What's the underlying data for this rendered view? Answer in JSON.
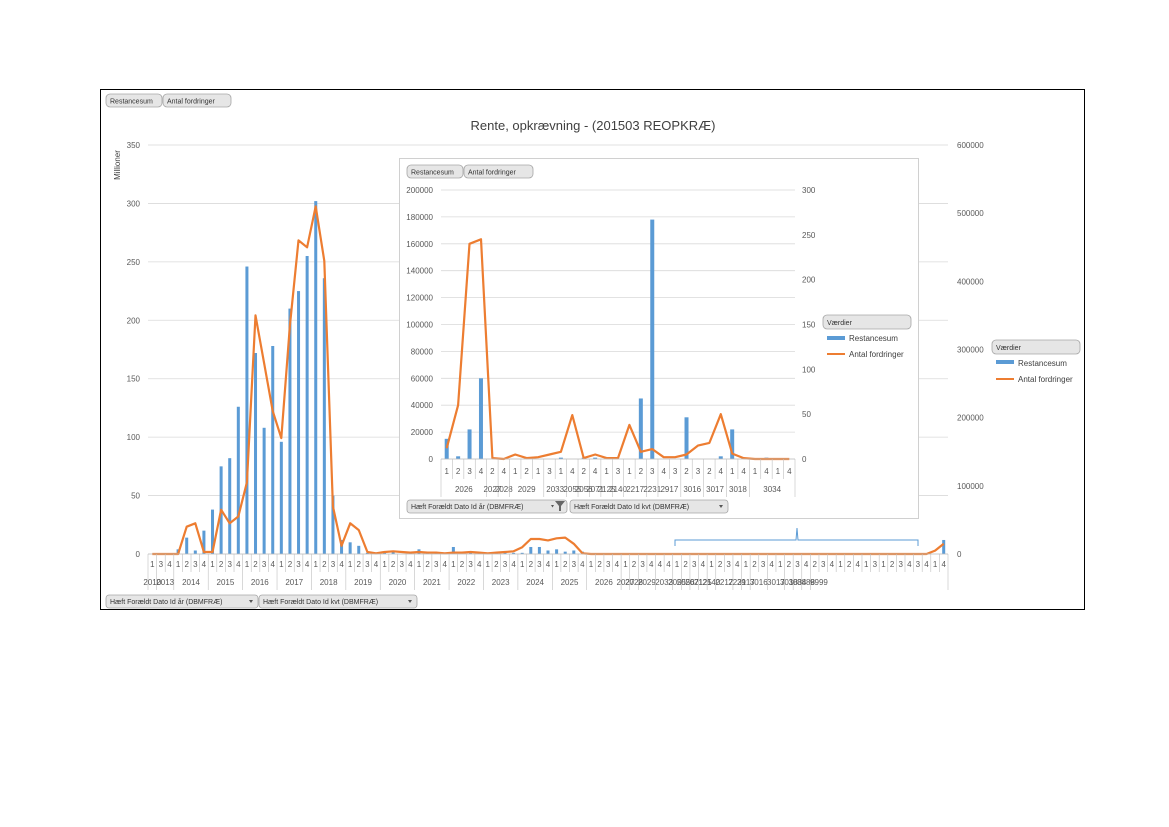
{
  "chart_data": [
    {
      "type": "bar",
      "title": "Rente, opkrævning - (201503 REOPKRÆ)",
      "ylabel": "Millioner",
      "ylim": [
        0,
        350
      ],
      "y2lim": [
        0,
        600000
      ],
      "yticks": [
        "0",
        "50",
        "100",
        "150",
        "200",
        "250",
        "300",
        "350"
      ],
      "y2ticks": [
        "0",
        "100000",
        "200000",
        "300000",
        "400000",
        "500000",
        "600000"
      ],
      "pivot_value_buttons": [
        "Restancesum",
        "Antal fordringer"
      ],
      "pivot_field_buttons": [
        "Hæft Forældt Dato Id år (DBMFRÆ)",
        "Hæft Forældt Dato Id kvt (DBMFRÆ)"
      ],
      "legend_title": "Værdier",
      "legend_position": "right",
      "grid": true,
      "quarters": [
        "1",
        "3",
        "4",
        "1",
        "2",
        "3",
        "4",
        "1",
        "2",
        "3",
        "4",
        "1",
        "2",
        "3",
        "4",
        "1",
        "2",
        "3",
        "4",
        "1",
        "2",
        "3",
        "4",
        "1",
        "2",
        "3",
        "4",
        "1",
        "2",
        "3",
        "4",
        "1",
        "2",
        "3",
        "4",
        "1",
        "2",
        "3",
        "4",
        "1",
        "2",
        "3",
        "4",
        "1",
        "2",
        "3",
        "4",
        "1",
        "2",
        "3",
        "4",
        "1",
        "2",
        "3",
        "4",
        "1",
        "2",
        "3",
        "4",
        "4",
        "4",
        "1",
        "2",
        "3",
        "4",
        "1",
        "2",
        "3",
        "4",
        "1",
        "2",
        "3",
        "4",
        "1",
        "2",
        "3",
        "4",
        "2",
        "3",
        "4",
        "1",
        "2",
        "4",
        "1",
        "3",
        "1",
        "2",
        "3",
        "4",
        "3",
        "4",
        "1",
        "4"
      ],
      "years": [
        {
          "label": "2010",
          "start": 0,
          "count": 1
        },
        {
          "label": "2013",
          "start": 1,
          "count": 2
        },
        {
          "label": "2014",
          "start": 3,
          "count": 4
        },
        {
          "label": "2015",
          "start": 7,
          "count": 4
        },
        {
          "label": "2016",
          "start": 11,
          "count": 4
        },
        {
          "label": "2017",
          "start": 15,
          "count": 4
        },
        {
          "label": "2018",
          "start": 19,
          "count": 4
        },
        {
          "label": "2019",
          "start": 23,
          "count": 4
        },
        {
          "label": "2020",
          "start": 27,
          "count": 4
        },
        {
          "label": "2021",
          "start": 31,
          "count": 4
        },
        {
          "label": "2022",
          "start": 35,
          "count": 4
        },
        {
          "label": "2023",
          "start": 39,
          "count": 4
        },
        {
          "label": "2024",
          "start": 43,
          "count": 4
        },
        {
          "label": "2025",
          "start": 47,
          "count": 4
        },
        {
          "label": "2026",
          "start": 51,
          "count": 4
        },
        {
          "label": "2027",
          "start": 55,
          "count": 1
        },
        {
          "label": "2028",
          "start": 56,
          "count": 1
        },
        {
          "label": "2029",
          "start": 57,
          "count": 2
        },
        {
          "label": "2033",
          "start": 59,
          "count": 2
        },
        {
          "label": "2055",
          "start": 61,
          "count": 1
        },
        {
          "label": "2056",
          "start": 62,
          "count": 1
        },
        {
          "label": "2071",
          "start": 63,
          "count": 1
        },
        {
          "label": "2125",
          "start": 64,
          "count": 1
        },
        {
          "label": "2140",
          "start": 65,
          "count": 1
        },
        {
          "label": "2217",
          "start": 66,
          "count": 2
        },
        {
          "label": "2231",
          "start": 68,
          "count": 1
        },
        {
          "label": "2917",
          "start": 69,
          "count": 1
        },
        {
          "label": "3016",
          "start": 70,
          "count": 2
        },
        {
          "label": "3017",
          "start": 72,
          "count": 2
        },
        {
          "label": "3018",
          "start": 74,
          "count": 1
        },
        {
          "label": "3034",
          "start": 75,
          "count": 1
        },
        {
          "label": "8888",
          "start": 76,
          "count": 1
        },
        {
          "label": "9999",
          "start": 77,
          "count": 2
        }
      ],
      "series": [
        {
          "name": "Restancesum",
          "type": "bar",
          "axis": "primary",
          "color": "#5b9bd5",
          "values": [
            0,
            0,
            0,
            4,
            14,
            3,
            20,
            38,
            75,
            82,
            126,
            246,
            172,
            108,
            178,
            96,
            210,
            225,
            255,
            302,
            236,
            50,
            12,
            10,
            7,
            1,
            0,
            1,
            3,
            0,
            1,
            4,
            2,
            1,
            0,
            6,
            0,
            1,
            1,
            1,
            1,
            1,
            1,
            1,
            6,
            6,
            3,
            4,
            2,
            3,
            2,
            0,
            0,
            0,
            0,
            0,
            0,
            0,
            0,
            0,
            0,
            0,
            0,
            0,
            0,
            0,
            0,
            0,
            0,
            0,
            0,
            0,
            0,
            0,
            0,
            0,
            0,
            0,
            0,
            0,
            0,
            0,
            0,
            0,
            0,
            0,
            0,
            0,
            0,
            0,
            0,
            0,
            12
          ]
        },
        {
          "name": "Antal fordringer",
          "type": "line",
          "axis": "secondary",
          "color": "#ed7d31",
          "values": [
            0,
            0,
            0,
            0,
            40000,
            45000,
            3000,
            3000,
            65000,
            45000,
            55000,
            105000,
            350000,
            280000,
            210000,
            170000,
            335000,
            460000,
            450000,
            510000,
            430000,
            70000,
            12000,
            45000,
            35000,
            3000,
            1000,
            3000,
            4000,
            3000,
            2000,
            3000,
            2000,
            2000,
            1000,
            2000,
            2000,
            3000,
            2000,
            1000,
            2000,
            3000,
            4000,
            10000,
            22000,
            22000,
            20000,
            23000,
            24000,
            15000,
            1000,
            0,
            0,
            0,
            0,
            0,
            0,
            0,
            0,
            0,
            0,
            0,
            0,
            0,
            0,
            0,
            0,
            0,
            0,
            0,
            0,
            0,
            0,
            0,
            0,
            0,
            0,
            0,
            0,
            0,
            0,
            0,
            0,
            0,
            0,
            0,
            0,
            0,
            0,
            0,
            0,
            5000,
            15000
          ]
        }
      ]
    },
    {
      "type": "bar",
      "ylim": [
        0,
        200000
      ],
      "y2lim": [
        0,
        300
      ],
      "yticks": [
        "0",
        "20000",
        "40000",
        "60000",
        "80000",
        "100000",
        "120000",
        "140000",
        "160000",
        "180000",
        "200000"
      ],
      "y2ticks": [
        "0",
        "50",
        "100",
        "150",
        "200",
        "250",
        "300"
      ],
      "pivot_value_buttons": [
        "Restancesum",
        "Antal fordringer"
      ],
      "pivot_field_buttons": [
        "Hæft Forældt Dato Id år (DBMFRÆ)",
        "Hæft Forældt Dato Id kvt (DBMFRÆ)"
      ],
      "legend_title": "Værdier",
      "legend_position": "right",
      "quarters": [
        "1",
        "2",
        "3",
        "4",
        "2",
        "4",
        "1",
        "2",
        "1",
        "3",
        "1",
        "4",
        "2",
        "4",
        "1",
        "3",
        "1",
        "2",
        "3",
        "4",
        "3",
        "2",
        "3",
        "2",
        "4",
        "1",
        "4",
        "1",
        "4",
        "1",
        "4"
      ],
      "years": [
        {
          "label": "2026",
          "start": 0,
          "count": 4
        },
        {
          "label": "2027",
          "start": 4,
          "count": 1
        },
        {
          "label": "2028",
          "start": 5,
          "count": 1
        },
        {
          "label": "2029",
          "start": 6,
          "count": 3
        },
        {
          "label": "2033",
          "start": 9,
          "count": 2
        },
        {
          "label": "2055",
          "start": 11,
          "count": 1
        },
        {
          "label": "2056",
          "start": 12,
          "count": 1
        },
        {
          "label": "2071",
          "start": 13,
          "count": 1
        },
        {
          "label": "2125",
          "start": 14,
          "count": 1
        },
        {
          "label": "2140",
          "start": 15,
          "count": 1
        },
        {
          "label": "2217",
          "start": 16,
          "count": 2
        },
        {
          "label": "2231",
          "start": 18,
          "count": 1
        },
        {
          "label": "2917",
          "start": 19,
          "count": 2
        },
        {
          "label": "3016",
          "start": 21,
          "count": 2
        },
        {
          "label": "3017",
          "start": 23,
          "count": 2
        },
        {
          "label": "3018",
          "start": 25,
          "count": 2
        },
        {
          "label": "3034",
          "start": 27,
          "count": 4
        }
      ],
      "series": [
        {
          "name": "Restancesum",
          "type": "bar",
          "axis": "primary",
          "color": "#5b9bd5",
          "values": [
            15000,
            2000,
            22000,
            60000,
            0,
            0,
            0,
            0,
            0,
            0,
            1000,
            0,
            1000,
            1000,
            0,
            0,
            0,
            45000,
            178000,
            0,
            0,
            31000,
            0,
            0,
            2000,
            22000,
            1000,
            0,
            1000,
            0,
            0
          ]
        },
        {
          "name": "Antal fordringer",
          "type": "line",
          "axis": "secondary",
          "color": "#ed7d31",
          "values": [
            12,
            60,
            240,
            245,
            1,
            0,
            5,
            1,
            2,
            5,
            8,
            49,
            1,
            5,
            1,
            1,
            38,
            8,
            11,
            2,
            2,
            5,
            15,
            18,
            50,
            6,
            1,
            0,
            0,
            0,
            0
          ]
        }
      ]
    }
  ]
}
